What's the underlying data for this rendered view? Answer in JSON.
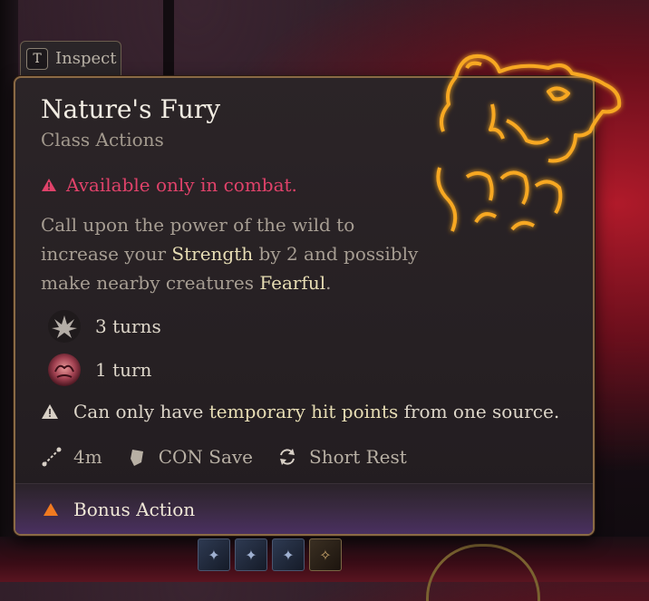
{
  "inspect": {
    "key": "T",
    "label": "Inspect"
  },
  "spell": {
    "name": "Nature's Fury",
    "category": "Class Actions",
    "requirement": "Available only in combat.",
    "description": {
      "part1": "Call upon the power of the wild to increase your ",
      "hl1": "Strength",
      "part2": " by 2 and possibly make nearby creatures ",
      "hl2": "Fearful",
      "part3": "."
    },
    "effects": [
      {
        "icon": "claw-icon",
        "duration": "3 turns"
      },
      {
        "icon": "fear-orb-icon",
        "duration": "1 turn"
      }
    ],
    "note": {
      "before": "Can only have ",
      "highlight": "temporary hit points",
      "after": " from one source."
    },
    "meta": {
      "range": "4m",
      "save": "CON Save",
      "recharge": "Short Rest"
    },
    "action_type": "Bonus Action"
  },
  "colors": {
    "accent_gold": "#f0a020",
    "warning_red": "#e0426a",
    "highlight": "#e7ddb4",
    "border": "#8a6a45"
  }
}
